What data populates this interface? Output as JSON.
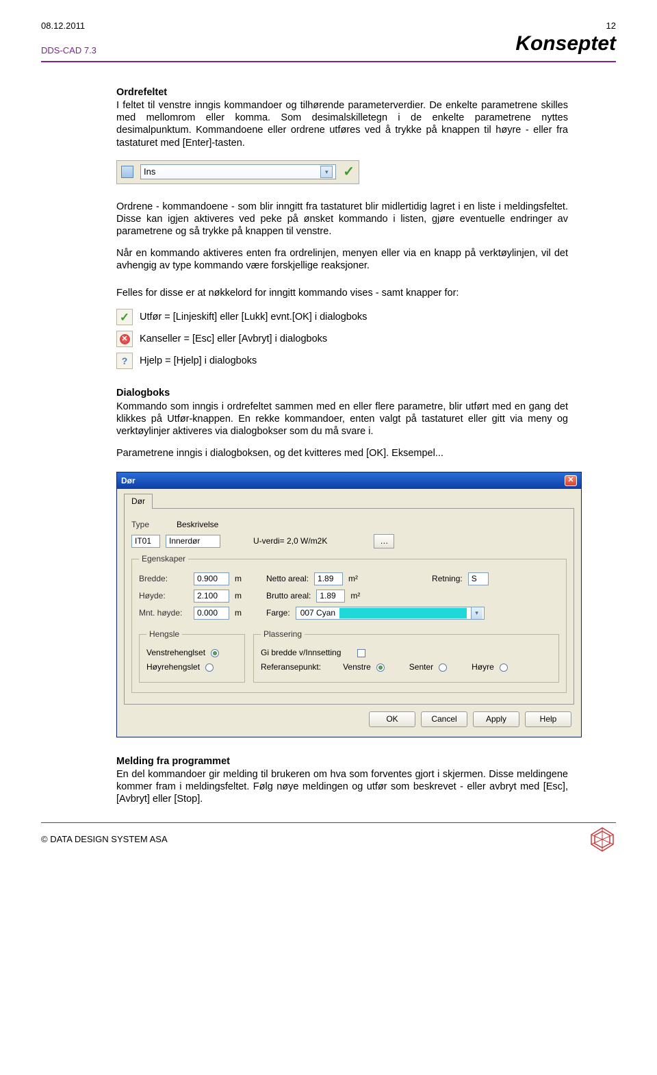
{
  "header": {
    "date": "08.12.2011",
    "pageNo": "12"
  },
  "title_row": {
    "app": "DDS-CAD 7.3",
    "title": "Konseptet"
  },
  "sec1": {
    "heading": "Ordrefeltet",
    "p1": "I feltet til venstre inngis kommandoer og tilhørende parameterverdier. De enkelte parametrene skilles med mellomrom eller komma. Som desimalskilletegn i de enkelte parametrene nyttes desimalpunktum. Kommandoene eller ordrene utføres ved å trykke på knappen til høyre - eller fra tastaturet med [Enter]-tasten."
  },
  "cmd": {
    "text": "Ins"
  },
  "sec2": {
    "p1": "Ordrene - kommandoene - som blir inngitt fra tastaturet blir midlertidig lagret i en liste i meldingsfeltet. Disse kan igjen aktiveres ved peke på ønsket kommando i listen, gjøre eventuelle endringer av parametrene og så trykke på knappen til venstre.",
    "p2": "Når en kommando aktiveres enten fra ordrelinjen, menyen eller via en knapp på verktøylinjen, vil det avhengig av type kommando være forskjellige reaksjoner."
  },
  "sec3": {
    "intro": "Felles for disse er at nøkkelord for inngitt kommando vises - samt knapper for:",
    "line1": "Utfør = [Linjeskift] eller [Lukk] evnt.[OK] i dialogboks",
    "line2": "Kanseller = [Esc] eller [Avbryt] i dialogboks",
    "line3": "Hjelp = [Hjelp] i dialogboks"
  },
  "sec4": {
    "heading": "Dialogboks",
    "p1": "Kommando som inngis i ordrefeltet sammen med en eller flere parametre, blir utført med en gang det klikkes på Utfør-knappen. En rekke kommandoer, enten valgt på tastaturet eller gitt via meny og verktøylinjer aktiveres via dialogbokser som du må svare i.",
    "p2": "Parametrene inngis i dialogboksen, og det kvitteres med [OK]. Eksempel..."
  },
  "dialog": {
    "title": "Dør",
    "tab": "Dør",
    "typeLabel": "Type",
    "descLabel": "Beskrivelse",
    "typeVal": "IT01",
    "descVal": "Innerdør",
    "uverdi": "U-verdi= 2,0 W/m2K",
    "groupProps": "Egenskaper",
    "bredde": "Bredde:",
    "breddeVal": "0.900",
    "m": "m",
    "hoyde": "Høyde:",
    "hoydeVal": "2.100",
    "mntHoyde": "Mnt. høyde:",
    "mntVal": "0.000",
    "nettoAreal": "Netto areal:",
    "nettoVal": "1.89",
    "bruttoAreal": "Brutto areal:",
    "bruttoVal": "1.89",
    "m2": "m²",
    "retning": "Retning:",
    "retningVal": "S",
    "farge": "Farge:",
    "fargeVal": "007   Cyan",
    "groupHengsle": "Hengsle",
    "venstrehengslet": "Venstrehenglset",
    "hoyrehengslet": "Høyrehengslet",
    "groupPlassering": "Plassering",
    "giBredde": "Gi bredde v/Innsetting",
    "refPunkt": "Referansepunkt:",
    "venstre": "Venstre",
    "senter": "Senter",
    "hoyre": "Høyre",
    "ok": "OK",
    "cancel": "Cancel",
    "apply": "Apply",
    "help": "Help"
  },
  "sec5": {
    "heading": "Melding fra programmet",
    "p1": "En del kommandoer gir melding til brukeren om hva som forventes gjort i skjermen. Disse meldingene kommer fram i meldingsfeltet. Følg nøye meldingen og utfør som beskrevet - eller avbryt med [Esc], [Avbryt] eller [Stop]."
  },
  "footer": {
    "text": "© DATA DESIGN SYSTEM ASA"
  }
}
